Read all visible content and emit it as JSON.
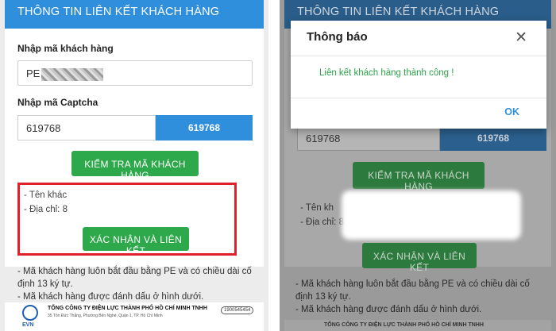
{
  "colors": {
    "primary": "#2f8fdc",
    "green": "#2da84a",
    "highlight_red": "#e0202a",
    "success_text": "#2ca24a"
  },
  "left": {
    "header_title": "THÔNG TIN LIÊN KẾT KHÁCH HÀNG",
    "customer_code_label": "Nhập mã khách hàng",
    "customer_code_value": "PE",
    "captcha_label": "Nhập mã Captcha",
    "captcha_value": "619768",
    "captcha_code": "619768",
    "check_button": "KIỂM TRA MÃ KHÁCH HÀNG",
    "name_line": "- Tên khác",
    "address_line": "- Địa chỉ: 8",
    "confirm_button": "XÁC NHẬN VÀ LIÊN KẾT",
    "note1": "- Mã khách hàng luôn bắt đầu bằng PE và có chiều dài cố định 13 ký tự.",
    "note2": "- Mã khách hàng được đánh dấu ở hình dưới.",
    "footer": {
      "logo_text": "EVN",
      "company": "TỔNG CÔNG TY ĐIỆN LỰC THÀNH PHỐ HỒ CHÍ MINH TNHH",
      "address": "35 Tôn Đức Thắng, Phường Bến Nghé, Quận 1, TP. Hồ Chí Minh",
      "hotline": "1900545454"
    }
  },
  "right": {
    "header_title": "THÔNG TIN LIÊN KẾT KHÁCH HÀNG",
    "captcha_value": "619768",
    "captcha_code": "619768",
    "check_button": "KIỂM TRA MÃ KHÁCH HÀNG",
    "name_line": "- Tên kh",
    "address_line": "- Địa chỉ: 8",
    "confirm_button": "XÁC NHẬN VÀ LIÊN KẾT",
    "note1": "- Mã khách hàng luôn bắt đầu bằng PE và có chiều dài cố định 13 ký tự.",
    "note2": "- Mã khách hàng được đánh dấu ở hình dưới.",
    "footer_company": "TỔNG CÔNG TY ĐIỆN LỰC THÀNH PHỐ HỒ CHÍ MINH TNHH"
  },
  "dialog": {
    "title": "Thông báo",
    "close_icon": "close-icon",
    "message": "Liên kết khách hàng thành công !",
    "ok_label": "OK"
  }
}
